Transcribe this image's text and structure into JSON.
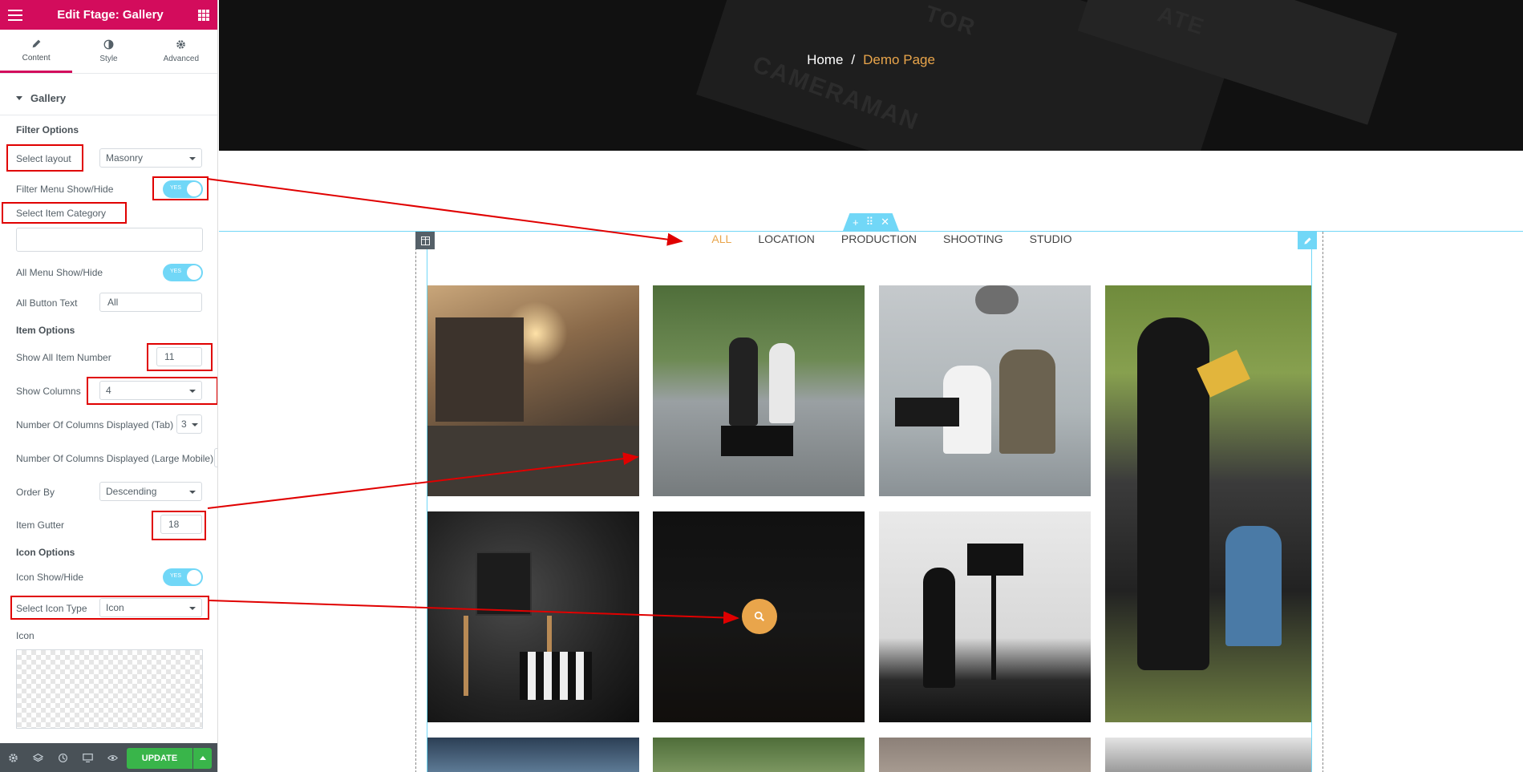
{
  "editor": {
    "title": "Edit Ftage: Gallery",
    "tabs": [
      {
        "label": "Content"
      },
      {
        "label": "Style"
      },
      {
        "label": "Advanced"
      }
    ],
    "section_title": "Gallery",
    "filter_options_heading": "Filter Options",
    "select_layout": {
      "label": "Select layout",
      "value": "Masonry"
    },
    "filter_menu_show_hide": {
      "label": "Filter Menu Show/Hide",
      "toggle": "YES"
    },
    "select_item_category": {
      "label": "Select Item Category",
      "value": ""
    },
    "all_menu_show_hide": {
      "label": "All Menu Show/Hide",
      "toggle": "YES"
    },
    "all_button_text": {
      "label": "All Button Text",
      "value": "All"
    },
    "item_options_heading": "Item Options",
    "show_all_item_number": {
      "label": "Show All Item Number",
      "value": "11"
    },
    "show_columns": {
      "label": "Show Columns",
      "value": "4"
    },
    "columns_tab": {
      "label": "Number Of Columns Displayed (Tab)",
      "value": "3"
    },
    "columns_large_mobile": {
      "label": "Number Of Columns Displayed (Large Mobile)"
    },
    "order_by": {
      "label": "Order By",
      "value": "Descending"
    },
    "item_gutter": {
      "label": "Item Gutter",
      "value": "18"
    },
    "icon_options_heading": "Icon Options",
    "icon_show_hide": {
      "label": "Icon Show/Hide",
      "toggle": "YES"
    },
    "select_icon_type": {
      "label": "Select Icon Type",
      "value": "Icon"
    },
    "icon_label": "Icon",
    "update_label": "UPDATE"
  },
  "page": {
    "breadcrumb": {
      "home": "Home",
      "separator": "/",
      "current": "Demo Page"
    },
    "hero_texts": [
      "TOR",
      "CAMERAMAN",
      "ATE"
    ],
    "filters": [
      "ALL",
      "LOCATION",
      "PRODUCTION",
      "SHOOTING",
      "STUDIO"
    ],
    "active_filter": "ALL"
  },
  "colors": {
    "brand": "#d30c5c",
    "accent": "#e9a54b",
    "editor_blue": "#71d7f7",
    "update_green": "#39b54a",
    "annotation_red": "#e00000"
  }
}
